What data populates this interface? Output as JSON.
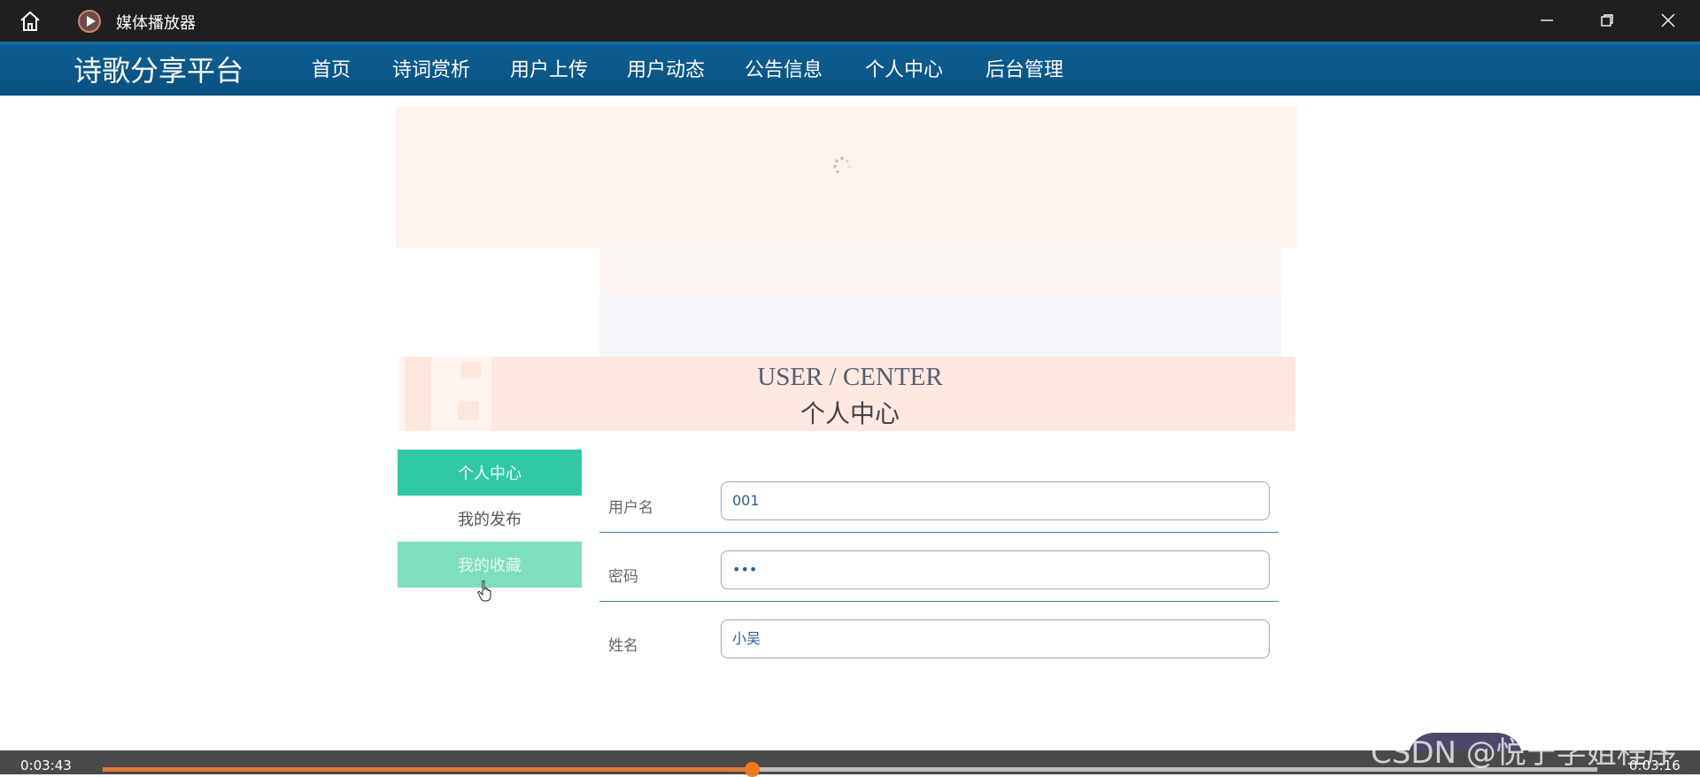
{
  "player": {
    "title": "媒体播放器",
    "current_time": "0:03:43",
    "total_time": "0:03:16",
    "progress_fraction": 0.434
  },
  "site": {
    "brand": "诗歌分享平台",
    "nav": [
      {
        "label": "首页",
        "active": false
      },
      {
        "label": "诗词赏析",
        "active": false
      },
      {
        "label": "用户上传",
        "active": false
      },
      {
        "label": "用户动态",
        "active": false
      },
      {
        "label": "公告信息",
        "active": false
      },
      {
        "label": "个人中心",
        "active": true
      },
      {
        "label": "后台管理",
        "active": false
      }
    ]
  },
  "page": {
    "title_en": "USER / CENTER",
    "title_cn": "个人中心",
    "sidebar": [
      {
        "label": "个人中心"
      },
      {
        "label": "我的发布"
      },
      {
        "label": "我的收藏"
      }
    ],
    "form": {
      "username_label": "用户名",
      "username_value": "001",
      "password_label": "密码",
      "password_value": "•••",
      "name_label": "姓名",
      "name_value": "小吴"
    }
  },
  "watermark": "CSDN @悦宁学姐程序",
  "colors": {
    "titlebar": "#1f1f1f",
    "nav": "#0a5182",
    "accent_green": "#2fc9a3",
    "progress": "#e87a2e"
  }
}
